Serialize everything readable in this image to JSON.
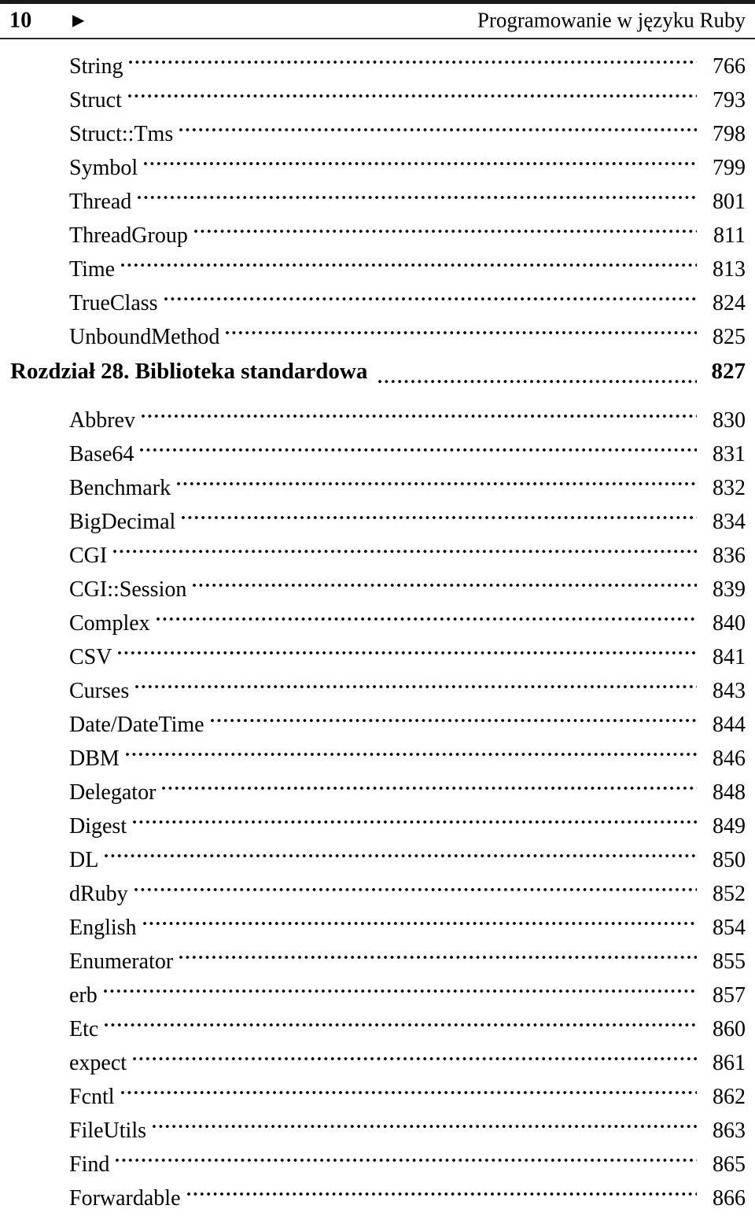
{
  "header": {
    "folio": "10",
    "marker_icon": "black-right-pointing-triangle",
    "marker": "▶",
    "title": "Programowanie w języku Ruby"
  },
  "toc": {
    "entries": [
      {
        "label": "String",
        "page": "766",
        "level": "entry"
      },
      {
        "label": "Struct",
        "page": "793",
        "level": "entry"
      },
      {
        "label": "Struct::Tms",
        "page": "798",
        "level": "entry"
      },
      {
        "label": "Symbol",
        "page": "799",
        "level": "entry"
      },
      {
        "label": "Thread",
        "page": "801",
        "level": "entry"
      },
      {
        "label": "ThreadGroup",
        "page": "811",
        "level": "entry"
      },
      {
        "label": "Time",
        "page": "813",
        "level": "entry"
      },
      {
        "label": "TrueClass",
        "page": "824",
        "level": "entry"
      },
      {
        "label": "UnboundMethod",
        "page": "825",
        "level": "entry"
      },
      {
        "label": "Rozdział 28. Biblioteka standardowa",
        "page": "827",
        "level": "chapter"
      },
      {
        "label": "Abbrev",
        "page": "830",
        "level": "entry"
      },
      {
        "label": "Base64",
        "page": "831",
        "level": "entry"
      },
      {
        "label": "Benchmark",
        "page": "832",
        "level": "entry"
      },
      {
        "label": "BigDecimal",
        "page": "834",
        "level": "entry"
      },
      {
        "label": "CGI",
        "page": "836",
        "level": "entry"
      },
      {
        "label": "CGI::Session",
        "page": "839",
        "level": "entry"
      },
      {
        "label": "Complex",
        "page": "840",
        "level": "entry"
      },
      {
        "label": "CSV",
        "page": "841",
        "level": "entry"
      },
      {
        "label": "Curses",
        "page": "843",
        "level": "entry"
      },
      {
        "label": "Date/DateTime",
        "page": "844",
        "level": "entry"
      },
      {
        "label": "DBM",
        "page": "846",
        "level": "entry"
      },
      {
        "label": "Delegator",
        "page": "848",
        "level": "entry"
      },
      {
        "label": "Digest",
        "page": "849",
        "level": "entry"
      },
      {
        "label": "DL",
        "page": "850",
        "level": "entry"
      },
      {
        "label": "dRuby",
        "page": "852",
        "level": "entry"
      },
      {
        "label": "English",
        "page": "854",
        "level": "entry"
      },
      {
        "label": "Enumerator",
        "page": "855",
        "level": "entry"
      },
      {
        "label": "erb",
        "page": "857",
        "level": "entry"
      },
      {
        "label": "Etc",
        "page": "860",
        "level": "entry"
      },
      {
        "label": "expect",
        "page": "861",
        "level": "entry"
      },
      {
        "label": "Fcntl",
        "page": "862",
        "level": "entry"
      },
      {
        "label": "FileUtils",
        "page": "863",
        "level": "entry"
      },
      {
        "label": "Find",
        "page": "865",
        "level": "entry"
      },
      {
        "label": "Forwardable",
        "page": "866",
        "level": "entry"
      }
    ]
  }
}
